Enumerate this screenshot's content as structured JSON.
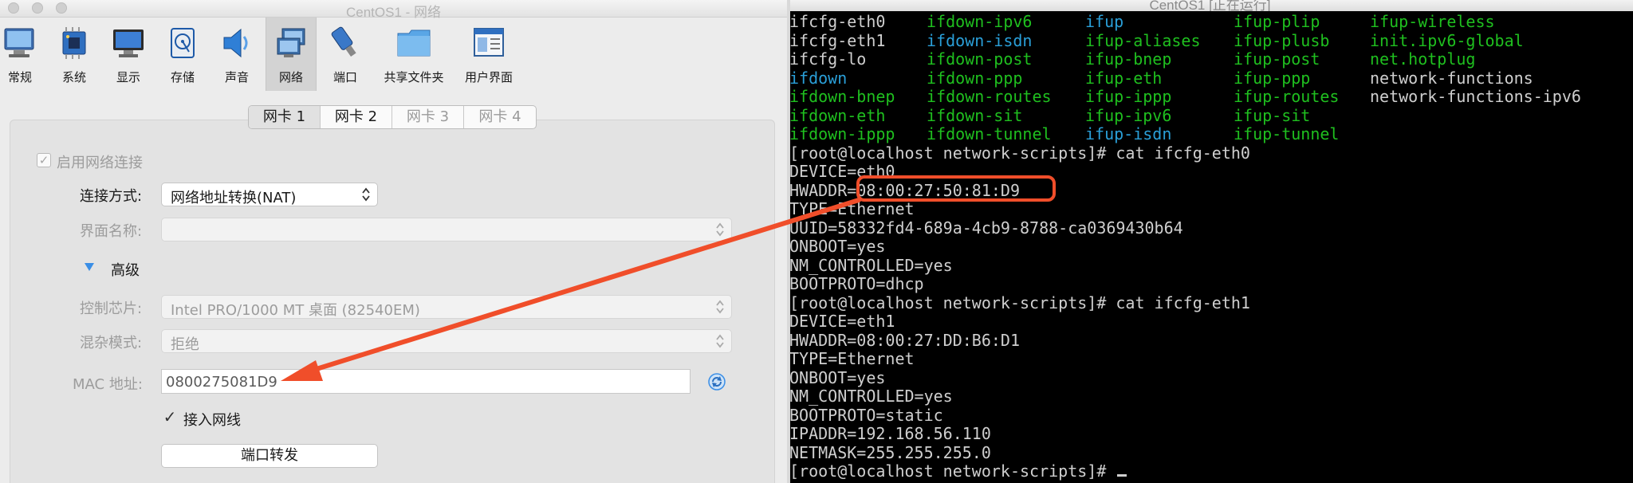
{
  "vbox": {
    "window_title": "CentOS1 - 网络",
    "toolbar": [
      {
        "label": "常规",
        "icon": "monitor-icon"
      },
      {
        "label": "系统",
        "icon": "chip-icon"
      },
      {
        "label": "显示",
        "icon": "display-icon"
      },
      {
        "label": "存储",
        "icon": "disk-icon"
      },
      {
        "label": "声音",
        "icon": "speaker-icon"
      },
      {
        "label": "网络",
        "icon": "network-icon"
      },
      {
        "label": "端口",
        "icon": "serial-port-icon"
      },
      {
        "label": "共享文件夹",
        "icon": "folder-icon"
      },
      {
        "label": "用户界面",
        "icon": "window-icon"
      }
    ],
    "tabs": [
      "网卡 1",
      "网卡 2",
      "网卡 3",
      "网卡 4"
    ],
    "enable_label": "启用网络连接",
    "attached_label": "连接方式:",
    "attached_value": "网络地址转换(NAT)",
    "name_label": "界面名称:",
    "advanced_label": "高级",
    "adapter_label": "控制芯片:",
    "adapter_value": "Intel PRO/1000 MT 桌面 (82540EM)",
    "promisc_label": "混杂模式:",
    "promisc_value": "拒绝",
    "mac_label": "MAC 地址:",
    "mac_value": "0800275081D9",
    "cable_label": "接入网线",
    "portfwd_label": "端口转发",
    "colors": {
      "accent": "#3a8ee6",
      "annotation": "#f04e2a"
    }
  },
  "terminal": {
    "title": "CentOS1 [正在运行]",
    "ls_rows": [
      [
        {
          "t": "ifcfg-eth0",
          "c": "w"
        },
        {
          "t": "ifdown-ipv6",
          "c": "g"
        },
        {
          "t": "ifup",
          "c": "b"
        },
        {
          "t": "ifup-plip",
          "c": "g"
        },
        {
          "t": "ifup-wireless",
          "c": "g"
        }
      ],
      [
        {
          "t": "ifcfg-eth1",
          "c": "w"
        },
        {
          "t": "ifdown-isdn",
          "c": "b"
        },
        {
          "t": "ifup-aliases",
          "c": "g"
        },
        {
          "t": "ifup-plusb",
          "c": "g"
        },
        {
          "t": "init.ipv6-global",
          "c": "g"
        }
      ],
      [
        {
          "t": "ifcfg-lo",
          "c": "w"
        },
        {
          "t": "ifdown-post",
          "c": "g"
        },
        {
          "t": "ifup-bnep",
          "c": "g"
        },
        {
          "t": "ifup-post",
          "c": "g"
        },
        {
          "t": "net.hotplug",
          "c": "g"
        }
      ],
      [
        {
          "t": "ifdown",
          "c": "b"
        },
        {
          "t": "ifdown-ppp",
          "c": "g"
        },
        {
          "t": "ifup-eth",
          "c": "g"
        },
        {
          "t": "ifup-ppp",
          "c": "g"
        },
        {
          "t": "network-functions",
          "c": "w"
        }
      ],
      [
        {
          "t": "ifdown-bnep",
          "c": "g"
        },
        {
          "t": "ifdown-routes",
          "c": "g"
        },
        {
          "t": "ifup-ippp",
          "c": "g"
        },
        {
          "t": "ifup-routes",
          "c": "g"
        },
        {
          "t": "network-functions-ipv6",
          "c": "w"
        }
      ],
      [
        {
          "t": "ifdown-eth",
          "c": "g"
        },
        {
          "t": "ifdown-sit",
          "c": "g"
        },
        {
          "t": "ifup-ipv6",
          "c": "g"
        },
        {
          "t": "ifup-sit",
          "c": "g"
        }
      ],
      [
        {
          "t": "ifdown-ippp",
          "c": "g"
        },
        {
          "t": "ifdown-tunnel",
          "c": "g"
        },
        {
          "t": "ifup-isdn",
          "c": "b"
        },
        {
          "t": "ifup-tunnel",
          "c": "g"
        }
      ]
    ],
    "lines": [
      "[root@localhost network-scripts]# cat ifcfg-eth0",
      "DEVICE=eth0",
      "HWADDR=08:00:27:50:81:D9",
      "TYPE=Ethernet",
      "UUID=58332fd4-689a-4cb9-8788-ca0369430b64",
      "ONBOOT=yes",
      "NM_CONTROLLED=yes",
      "BOOTPROTO=dhcp",
      "[root@localhost network-scripts]# cat ifcfg-eth1",
      "DEVICE=eth1",
      "HWADDR=08:00:27:DD:B6:D1",
      "TYPE=Ethernet",
      "ONBOOT=yes",
      "NM_CONTROLLED=yes",
      "BOOTPROTO=static",
      "IPADDR=192.168.56.110",
      "NETMASK=255.255.255.0",
      "[root@localhost network-scripts]# "
    ],
    "colors": {
      "w": "#cfcfcf",
      "g": "#1fbf1f",
      "b": "#2a9fd8"
    }
  }
}
